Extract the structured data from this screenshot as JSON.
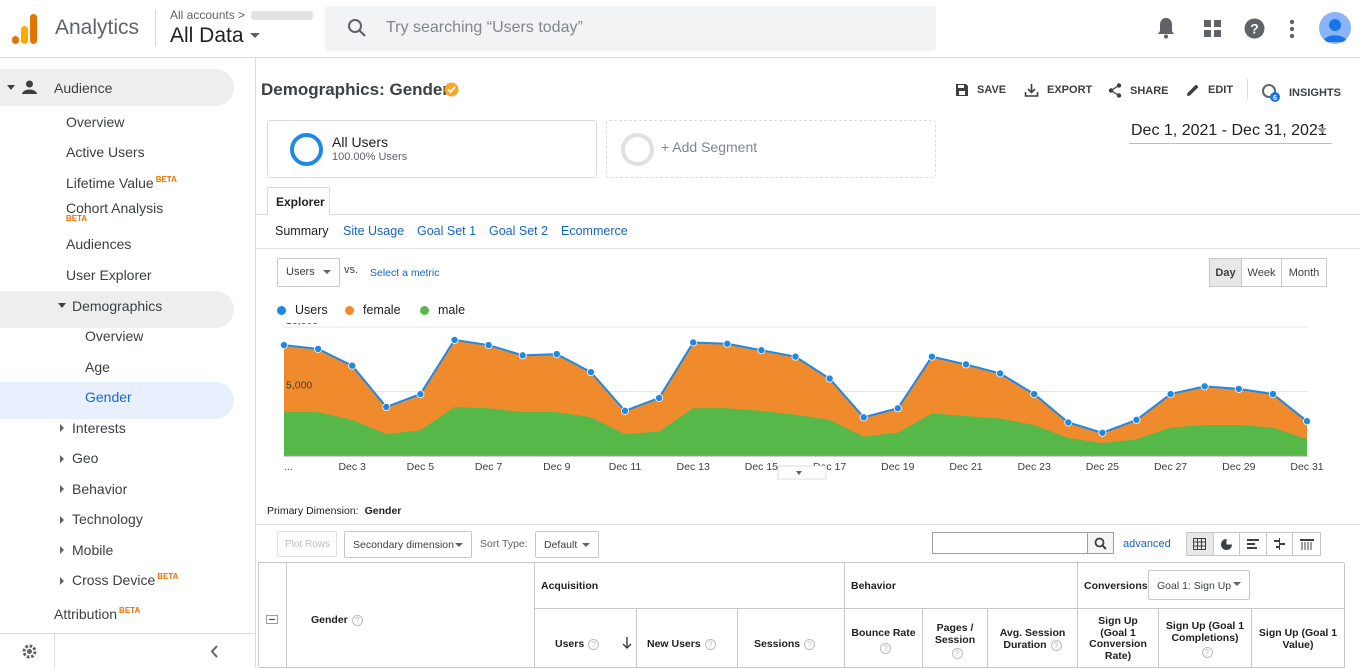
{
  "header": {
    "app_name": "Analytics",
    "account_crumb": "All accounts",
    "view_name": "All Data",
    "search_placeholder": "Try searching “Users today”"
  },
  "sidebar": {
    "audience": "Audience",
    "items": [
      "Overview",
      "Active Users",
      "Lifetime Value",
      "Cohort Analysis",
      "Audiences",
      "User Explorer"
    ],
    "beta": "BETA",
    "demographics": "Demographics",
    "demo_items": [
      "Overview",
      "Age",
      "Gender"
    ],
    "collapsed": [
      "Interests",
      "Geo",
      "Behavior",
      "Technology",
      "Mobile",
      "Cross Device"
    ],
    "attribution": "Attribution"
  },
  "page": {
    "title": "Demographics: Gender",
    "toolbar": [
      "SAVE",
      "EXPORT",
      "SHARE",
      "EDIT",
      "INSIGHTS"
    ],
    "insights_badge": "6",
    "segment_title": "All Users",
    "segment_sub": "100.00% Users",
    "add_segment": "+ Add Segment",
    "date_range": "Dec 1, 2021 - Dec 31, 2021",
    "tab": "Explorer",
    "subtabs": [
      "Summary",
      "Site Usage",
      "Goal Set 1",
      "Goal Set 2",
      "Ecommerce"
    ],
    "metric_select": "Users",
    "vs": "vs.",
    "select_metric": "Select a metric",
    "periods": [
      "Day",
      "Week",
      "Month"
    ]
  },
  "chart_data": {
    "type": "area",
    "series": [
      {
        "name": "Users",
        "color": "#1e88e5",
        "values": [
          8600,
          8300,
          7000,
          3800,
          4800,
          9000,
          8600,
          7800,
          7900,
          6500,
          3500,
          4500,
          8800,
          8700,
          8200,
          7700,
          6000,
          3000,
          3700,
          7700,
          7100,
          6400,
          4800,
          2600,
          1800,
          2800,
          4800,
          5400,
          5200,
          4800,
          2700
        ]
      },
      {
        "name": "female",
        "color": "#ef8b2c",
        "values": []
      },
      {
        "name": "male",
        "color": "#56b848",
        "values": [
          3400,
          3400,
          2800,
          1700,
          2000,
          3800,
          3700,
          3400,
          3400,
          3000,
          1700,
          1900,
          3700,
          3700,
          3500,
          3200,
          2800,
          1500,
          1800,
          3300,
          3100,
          2900,
          2400,
          1400,
          1000,
          1300,
          2200,
          2400,
          2400,
          2200,
          1300
        ]
      }
    ],
    "yticks": [
      "10,000",
      "5,000"
    ],
    "xticks": [
      "...",
      "Dec 3",
      "Dec 5",
      "Dec 7",
      "Dec 9",
      "Dec 11",
      "Dec 13",
      "Dec 15",
      "Dec 17",
      "Dec 19",
      "Dec 21",
      "Dec 23",
      "Dec 25",
      "Dec 27",
      "Dec 29",
      "Dec 31"
    ],
    "ylim": [
      0,
      10000
    ]
  },
  "table": {
    "primary_label": "Primary Dimension:",
    "primary_value": "Gender",
    "plot_rows": "Plot Rows",
    "secondary": "Secondary dimension",
    "sort_label": "Sort Type:",
    "sort_value": "Default",
    "advanced": "advanced",
    "col_gender": "Gender",
    "group_acq": "Acquisition",
    "group_beh": "Behavior",
    "group_conv": "Conversions",
    "goal_select": "Goal 1: Sign Up",
    "cols": [
      "Users",
      "New Users",
      "Sessions",
      "Bounce Rate",
      "Pages / Session",
      "Avg. Session Duration",
      "Sign Up (Goal 1 Conversion Rate)",
      "Sign Up (Goal 1 Completions)",
      "Sign Up (Goal 1 Value)"
    ]
  }
}
